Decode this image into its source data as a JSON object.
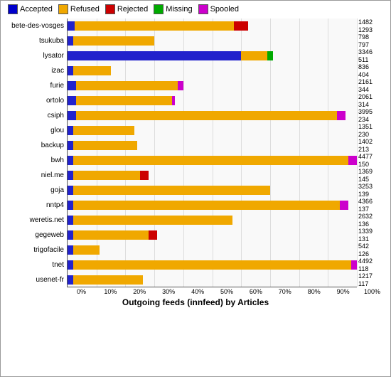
{
  "legend": {
    "items": [
      {
        "label": "Accepted",
        "color": "#0000cc",
        "name": "accepted"
      },
      {
        "label": "Refused",
        "color": "#f0a800",
        "name": "refused"
      },
      {
        "label": "Rejected",
        "color": "#cc0000",
        "name": "rejected"
      },
      {
        "label": "Missing",
        "color": "#00aa00",
        "name": "missing"
      },
      {
        "label": "Spooled",
        "color": "#cc00cc",
        "name": "spooled"
      }
    ]
  },
  "title": "Outgoing feeds (innfeed) by Articles",
  "xLabels": [
    "0%",
    "10%",
    "20%",
    "30%",
    "40%",
    "50%",
    "60%",
    "70%",
    "80%",
    "90%",
    "100%"
  ],
  "rows": [
    {
      "name": "bete-des-vosges",
      "accepted": 2.5,
      "refused": 55,
      "rejected": 5,
      "missing": 0,
      "spooled": 0,
      "val1": "1482",
      "val2": "1293"
    },
    {
      "name": "tsukuba",
      "accepted": 2,
      "refused": 28,
      "rejected": 0,
      "missing": 0,
      "spooled": 0,
      "val1": "798",
      "val2": "797"
    },
    {
      "name": "lysator",
      "accepted": 60,
      "refused": 9,
      "rejected": 0,
      "missing": 2,
      "spooled": 0,
      "val1": "3346",
      "val2": "511"
    },
    {
      "name": "izac",
      "accepted": 2,
      "refused": 13,
      "rejected": 0,
      "missing": 0,
      "spooled": 0,
      "val1": "836",
      "val2": "404"
    },
    {
      "name": "furie",
      "accepted": 3,
      "refused": 35,
      "rejected": 0,
      "missing": 0,
      "spooled": 2,
      "val1": "2161",
      "val2": "344"
    },
    {
      "name": "ortolo",
      "accepted": 3,
      "refused": 33,
      "rejected": 0,
      "missing": 0,
      "spooled": 1,
      "val1": "2061",
      "val2": "314"
    },
    {
      "name": "csiph",
      "accepted": 3,
      "refused": 90,
      "rejected": 0,
      "missing": 0,
      "spooled": 3,
      "val1": "3995",
      "val2": "234"
    },
    {
      "name": "glou",
      "accepted": 2,
      "refused": 21,
      "rejected": 0,
      "missing": 0,
      "spooled": 0,
      "val1": "1351",
      "val2": "230"
    },
    {
      "name": "backup",
      "accepted": 2,
      "refused": 22,
      "rejected": 0,
      "missing": 0,
      "spooled": 0,
      "val1": "1402",
      "val2": "213"
    },
    {
      "name": "bwh",
      "accepted": 2,
      "refused": 95,
      "rejected": 0,
      "missing": 0,
      "spooled": 3,
      "val1": "4477",
      "val2": "150"
    },
    {
      "name": "niel.me",
      "accepted": 2,
      "refused": 23,
      "rejected": 3,
      "missing": 0,
      "spooled": 0,
      "val1": "1369",
      "val2": "145"
    },
    {
      "name": "goja",
      "accepted": 2,
      "refused": 68,
      "rejected": 0,
      "missing": 0,
      "spooled": 0,
      "val1": "3253",
      "val2": "139"
    },
    {
      "name": "nntp4",
      "accepted": 2,
      "refused": 92,
      "rejected": 0,
      "missing": 0,
      "spooled": 3,
      "val1": "4366",
      "val2": "137"
    },
    {
      "name": "weretis.net",
      "accepted": 2,
      "refused": 55,
      "rejected": 0,
      "missing": 0,
      "spooled": 0,
      "val1": "2632",
      "val2": "136"
    },
    {
      "name": "gegeweb",
      "accepted": 2,
      "refused": 26,
      "rejected": 3,
      "missing": 0,
      "spooled": 0,
      "val1": "1339",
      "val2": "131"
    },
    {
      "name": "trigofacile",
      "accepted": 2,
      "refused": 9,
      "rejected": 0,
      "missing": 0,
      "spooled": 0,
      "val1": "542",
      "val2": "126"
    },
    {
      "name": "tnet",
      "accepted": 2,
      "refused": 96,
      "rejected": 0,
      "missing": 0,
      "spooled": 2,
      "val1": "4492",
      "val2": "118"
    },
    {
      "name": "usenet-fr",
      "accepted": 2,
      "refused": 24,
      "rejected": 0,
      "missing": 0,
      "spooled": 0,
      "val1": "1217",
      "val2": "117"
    }
  ],
  "colors": {
    "accepted": "#2222cc",
    "refused": "#f0a800",
    "rejected": "#cc0000",
    "missing": "#00aa00",
    "spooled": "#cc00cc",
    "background": "#f9f9f9",
    "border": "#888888"
  }
}
